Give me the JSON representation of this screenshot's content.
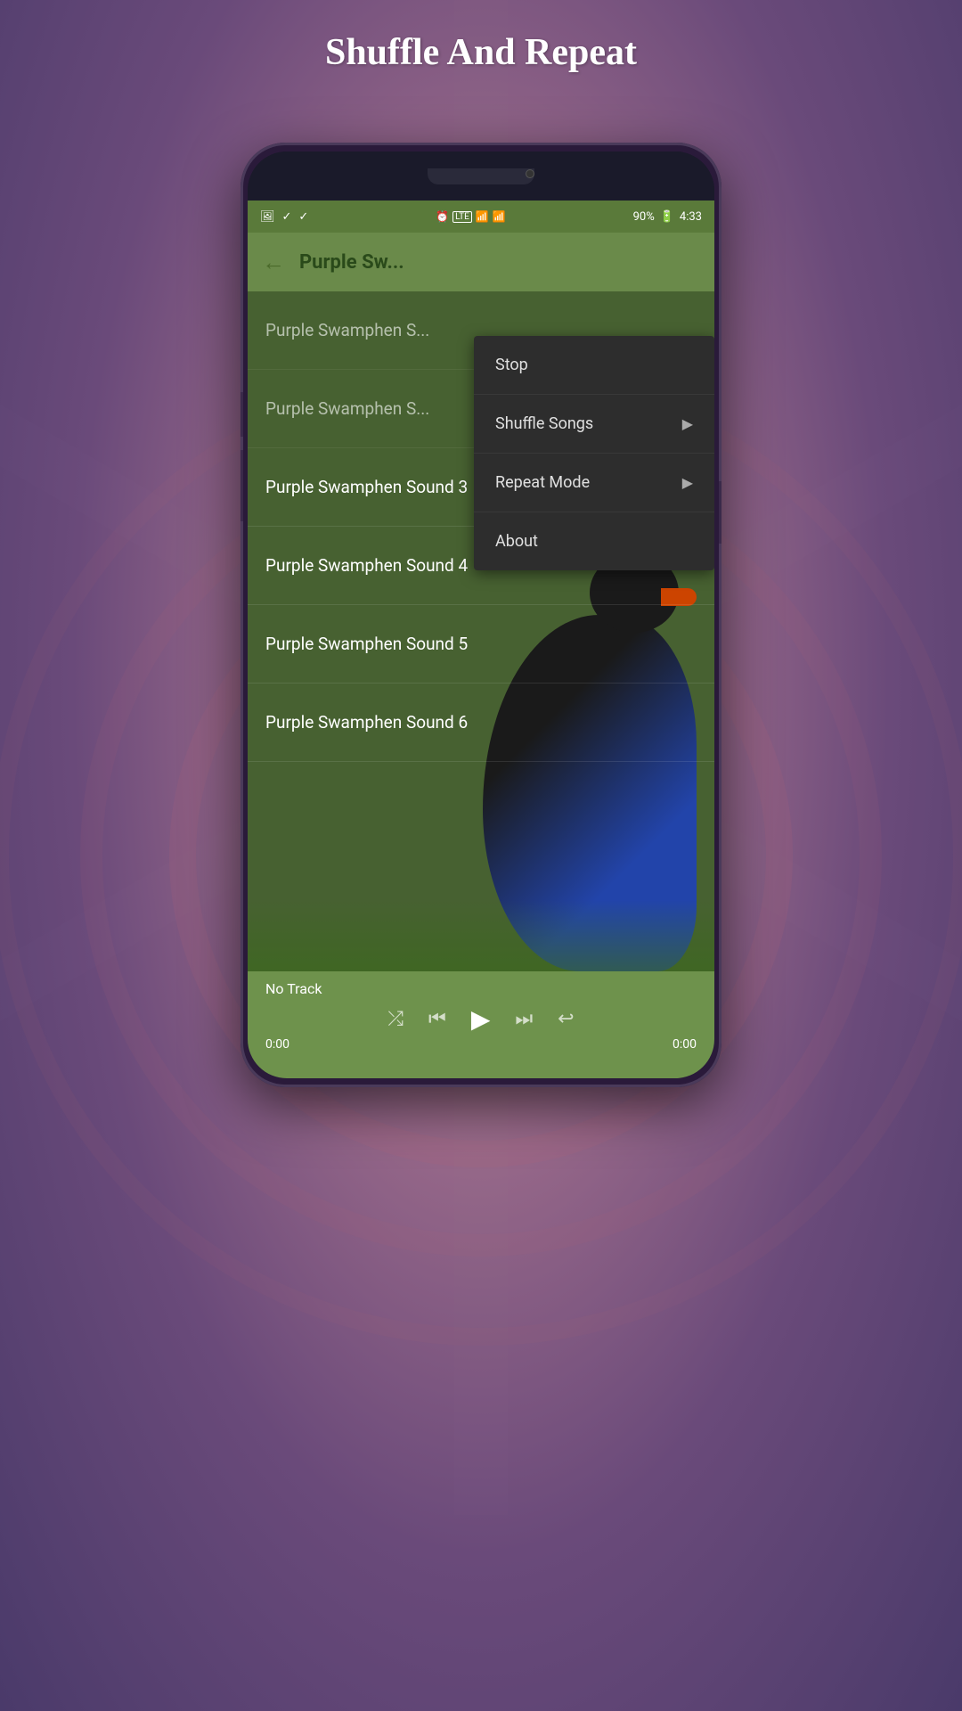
{
  "page": {
    "title": "Shuffle And Repeat",
    "background_color": "#7a5a8a"
  },
  "status_bar": {
    "icons_left": [
      "alarm-icon",
      "lte-icon",
      "wifi-icon",
      "signal-icon"
    ],
    "battery": "90%",
    "time": "4:33"
  },
  "toolbar": {
    "back_label": "←",
    "title": "Purple Sw..."
  },
  "song_list": {
    "items": [
      {
        "label": "Purple Swamphen S..."
      },
      {
        "label": "Purple Swamphen S..."
      },
      {
        "label": "Purple Swamphen Sound 3"
      },
      {
        "label": "Purple Swamphen Sound 4"
      },
      {
        "label": "Purple Swamphen Sound 5"
      },
      {
        "label": "Purple Swamphen Sound 6"
      }
    ]
  },
  "dropdown_menu": {
    "items": [
      {
        "label": "Stop",
        "has_submenu": false
      },
      {
        "label": "Shuffle Songs",
        "has_submenu": true
      },
      {
        "label": "Repeat Mode",
        "has_submenu": true
      },
      {
        "label": "About",
        "has_submenu": false
      }
    ]
  },
  "player": {
    "track_label": "No Track",
    "time_current": "0:00",
    "time_total": "0:00",
    "controls": {
      "shuffle": "⤮",
      "prev": "⏮",
      "play": "▶",
      "next": "⏭",
      "repeat": "↩"
    }
  }
}
